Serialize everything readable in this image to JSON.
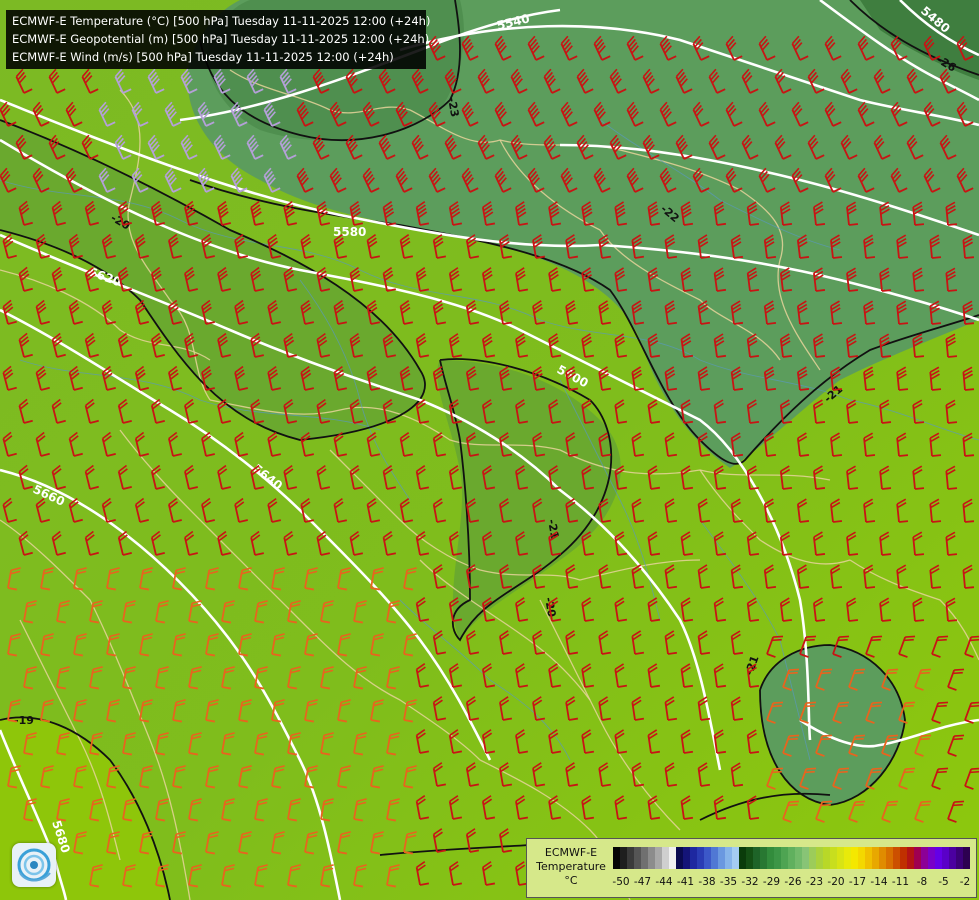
{
  "titles": [
    "ECMWF-E Temperature (°C) [500 hPa] Tuesday 11-11-2025 12:00 (+24h)",
    "ECMWF-E Geopotential (m) [500 hPa] Tuesday 11-11-2025 12:00 (+24h)",
    "ECMWF-E Wind (m/s) [500 hPa] Tuesday 11-11-2025 12:00 (+24h)"
  ],
  "legend": {
    "line1": "ECMWF-E",
    "line2": "Temperature",
    "unit": "°C",
    "ticks": [
      "-50",
      "-47",
      "-44",
      "-41",
      "-38",
      "-35",
      "-32",
      "-29",
      "-26",
      "-23",
      "-20",
      "-17",
      "-14",
      "-11",
      "-8",
      "-5",
      "-2"
    ],
    "colors": [
      "#050505",
      "#1e1e1e",
      "#3a3a3a",
      "#555555",
      "#707070",
      "#8c8c8c",
      "#a8a8a8",
      "#cfcfcf",
      "#f0f0f0",
      "#0a0a50",
      "#141478",
      "#1e28a0",
      "#2a3cb4",
      "#3c58c8",
      "#5078d4",
      "#6a98e0",
      "#86b4ea",
      "#a4ccf2",
      "#0a3c0a",
      "#145014",
      "#1e6428",
      "#287832",
      "#328c3c",
      "#3c9646",
      "#4ea452",
      "#60b05e",
      "#72ba6a",
      "#88c476",
      "#9ccc5a",
      "#aad23c",
      "#b8d828",
      "#c8de1e",
      "#d8e414",
      "#e8ea0a",
      "#f4e800",
      "#f4d800",
      "#f0c000",
      "#e8a800",
      "#e08c00",
      "#d87000",
      "#cc5000",
      "#c03000",
      "#b41414",
      "#a00050",
      "#8c0096",
      "#7800c8",
      "#6400e6",
      "#5a00c8",
      "#4b00a0",
      "#3c0078",
      "#2d0050"
    ]
  },
  "geopotential_labels": [
    "5540",
    "5580",
    "5620",
    "5600",
    "5640",
    "5660",
    "5680",
    "5480"
  ],
  "temperature_labels": [
    "-23",
    "-20",
    "-22",
    "-21",
    "-21",
    "-20",
    "-19",
    "-26",
    "-21"
  ],
  "colors": {
    "background_warm": "#8cc41a",
    "background_mid": "#6aac2e",
    "cold_region": "#5a9e5e",
    "coldest_region": "#3d7d3d",
    "geopotential_contour": "#ffffff",
    "temperature_contour": "#111111",
    "border": "#e8d89a",
    "river": "#5f9fc0",
    "barb_strong": "#c81414",
    "barb_medium": "#e8641e",
    "barb_weak": "#b4a0d8"
  }
}
